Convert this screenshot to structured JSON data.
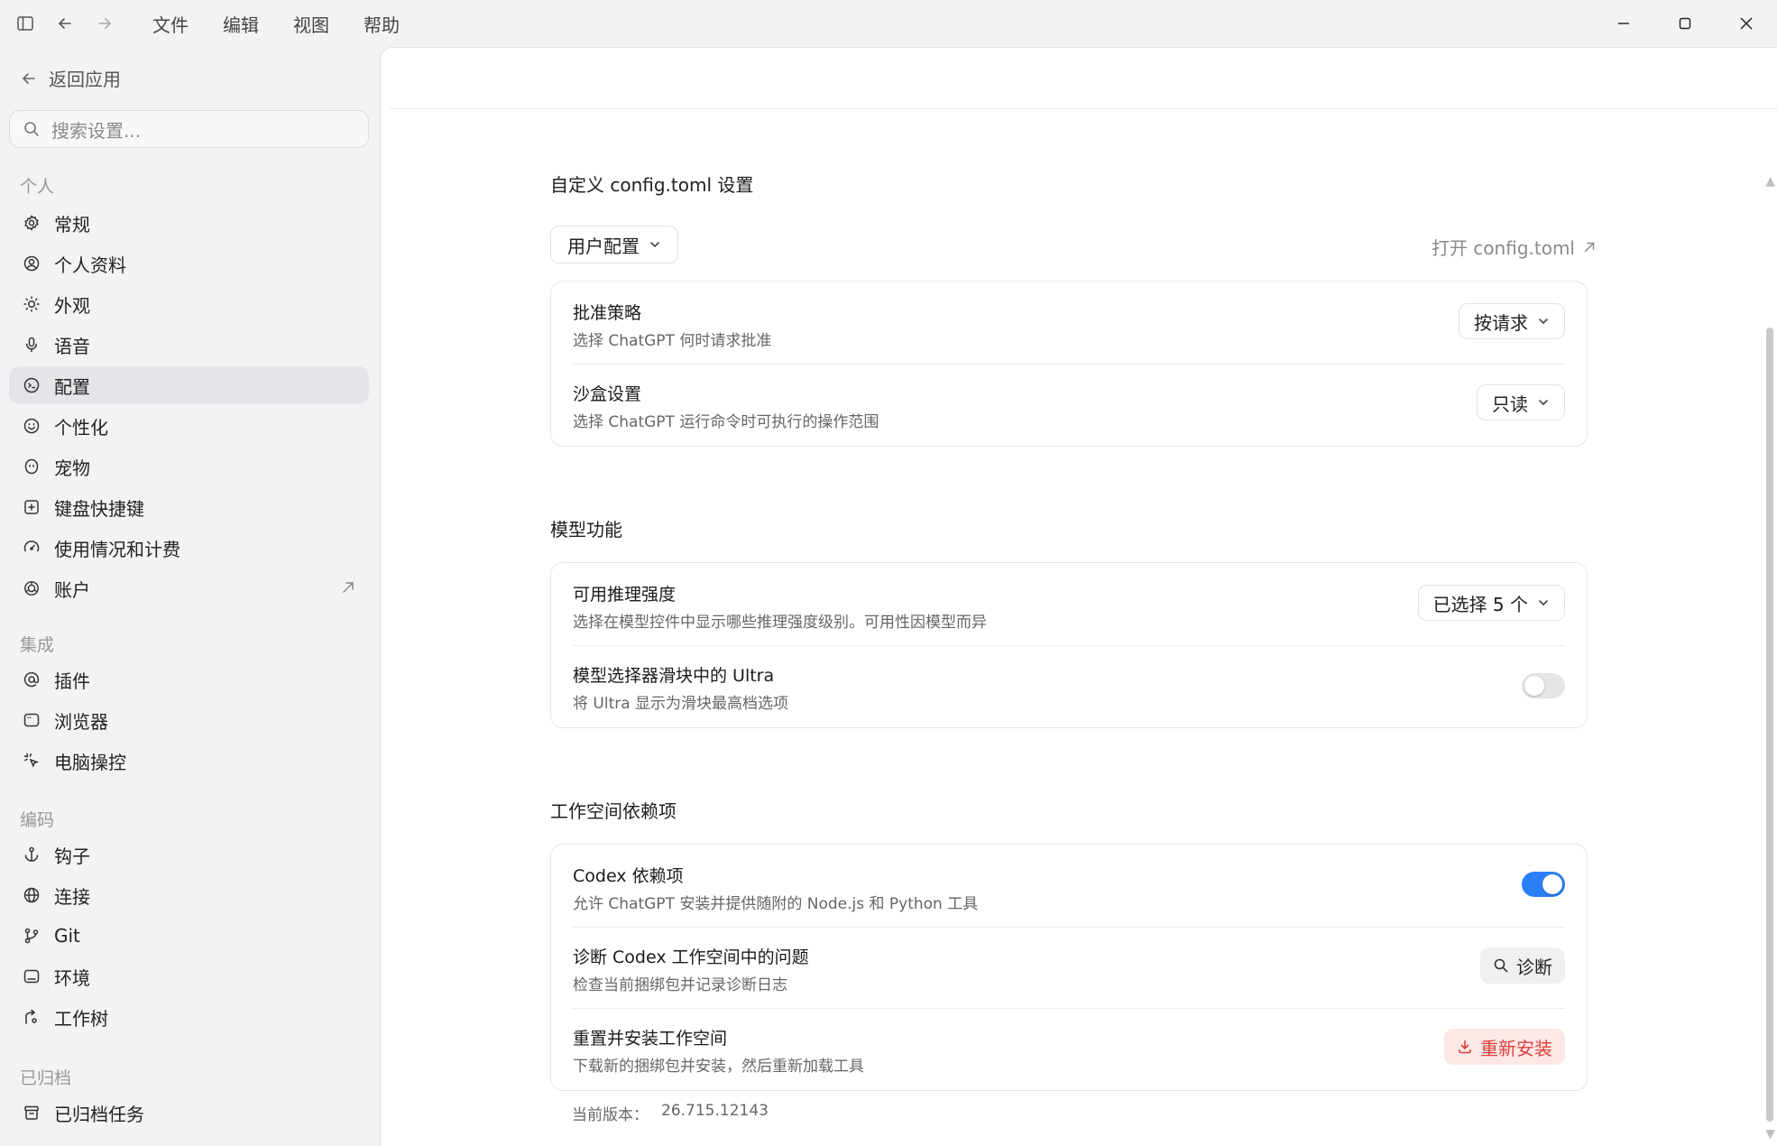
{
  "menu": [
    "文件",
    "编辑",
    "视图",
    "帮助"
  ],
  "sidebar": {
    "back_label": "返回应用",
    "search_placeholder": "搜索设置...",
    "sections": {
      "personal": "个人",
      "integrations": "集成",
      "coding": "编码",
      "archived": "已归档"
    },
    "items": {
      "general": "常规",
      "profile": "个人资料",
      "appearance": "外观",
      "voice": "语音",
      "config": "配置",
      "personalization": "个性化",
      "pets": "宠物",
      "shortcuts": "键盘快捷键",
      "usage": "使用情况和计费",
      "account": "账户",
      "plugins": "插件",
      "browser": "浏览器",
      "computer_use": "电脑操控",
      "hooks": "钩子",
      "connections": "连接",
      "git": "Git",
      "environment": "环境",
      "worktree": "工作树",
      "archived_tasks": "已归档任务"
    }
  },
  "main": {
    "config_section": {
      "title": "自定义 config.toml 设置",
      "profile_dropdown": "用户配置",
      "open_link": "打开 config.toml",
      "approval": {
        "title": "批准策略",
        "desc": "选择 ChatGPT 何时请求批准",
        "value": "按请求"
      },
      "sandbox": {
        "title": "沙盒设置",
        "desc": "选择 ChatGPT 运行命令时可执行的操作范围",
        "value": "只读"
      }
    },
    "model_section": {
      "title": "模型功能",
      "reasoning": {
        "title": "可用推理强度",
        "desc": "选择在模型控件中显示哪些推理强度级别。可用性因模型而异",
        "value": "已选择 5 个"
      },
      "ultra": {
        "title": "模型选择器滑块中的 Ultra",
        "desc": "将 Ultra 显示为滑块最高档选项",
        "enabled": false
      }
    },
    "workspace_section": {
      "title": "工作空间依赖项",
      "codex_deps": {
        "title": "Codex 依赖项",
        "desc": "允许 ChatGPT 安装并提供随附的 Node.js 和 Python 工具",
        "enabled": true
      },
      "diagnose": {
        "title": "诊断 Codex 工作空间中的问题",
        "desc": "检查当前捆绑包并记录诊断日志",
        "button": "诊断"
      },
      "reinstall": {
        "title": "重置并安装工作空间",
        "desc": "下载新的捆绑包并安装，然后重新加载工具",
        "button": "重新安装"
      },
      "version_label": "当前版本：",
      "version_value": "26.715.12143"
    }
  },
  "colors": {
    "accent": "#2b7ff5",
    "danger": "#e0403a",
    "danger_bg": "#fde8e8"
  }
}
